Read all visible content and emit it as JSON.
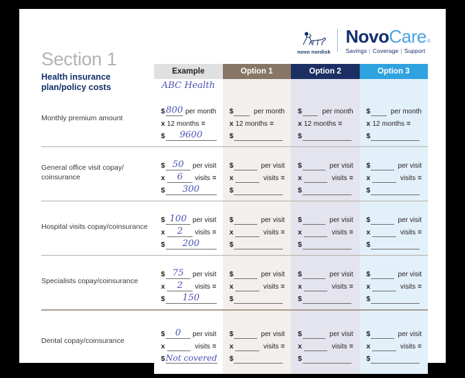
{
  "logo": {
    "brand_sub": "novo nordisk",
    "name_first": "Novo",
    "name_second": "Care",
    "registered": "®",
    "tagline_items": [
      "Savings",
      "Coverage",
      "Support"
    ],
    "separator": "|"
  },
  "section": {
    "number_label": "Section 1",
    "subtitle": "Health insurance\nplan/policy costs"
  },
  "colors": {
    "option1": "#877566",
    "option2": "#1b2f63",
    "option3": "#2fa2e0",
    "example_header": "#e0e0e0",
    "navy_text": "#14306b",
    "handwriting": "#4a50b4"
  },
  "columns": {
    "label": "",
    "example": "Example",
    "option1": "Option 1",
    "option2": "Option 2",
    "option3": "Option 3"
  },
  "example_plan_name": "ABC Health",
  "labels": {
    "per_month": "per month",
    "per_visit": "per visit",
    "months_12": "12 months",
    "visits": "visits",
    "equals": "=",
    "dollar": "$",
    "times": "x"
  },
  "rows": [
    {
      "label": "Monthly premium amount",
      "unit": "per month",
      "qty_label": "12 months",
      "qty_fixed": true,
      "example": {
        "rate": "800",
        "qty": "12",
        "total": "9600"
      }
    },
    {
      "label": "General office visit copay/\ncoinsurance",
      "unit": "per visit",
      "qty_label": "visits",
      "qty_fixed": false,
      "example": {
        "rate": "50",
        "qty": "6",
        "total": "300"
      }
    },
    {
      "label": "Hospital visits copay/coinsurance",
      "unit": "per visit",
      "qty_label": "visits",
      "qty_fixed": false,
      "example": {
        "rate": "100",
        "qty": "2",
        "total": "200"
      }
    },
    {
      "label": "Specialists copay/coinsurance",
      "unit": "per visit",
      "qty_label": "visits",
      "qty_fixed": false,
      "example": {
        "rate": "75",
        "qty": "2",
        "total": "150"
      }
    },
    {
      "label": "Dental copay/coinsurance",
      "unit": "per visit",
      "qty_label": "visits",
      "qty_fixed": false,
      "example": {
        "rate": "0",
        "qty": "",
        "total": "Not covered"
      }
    }
  ]
}
